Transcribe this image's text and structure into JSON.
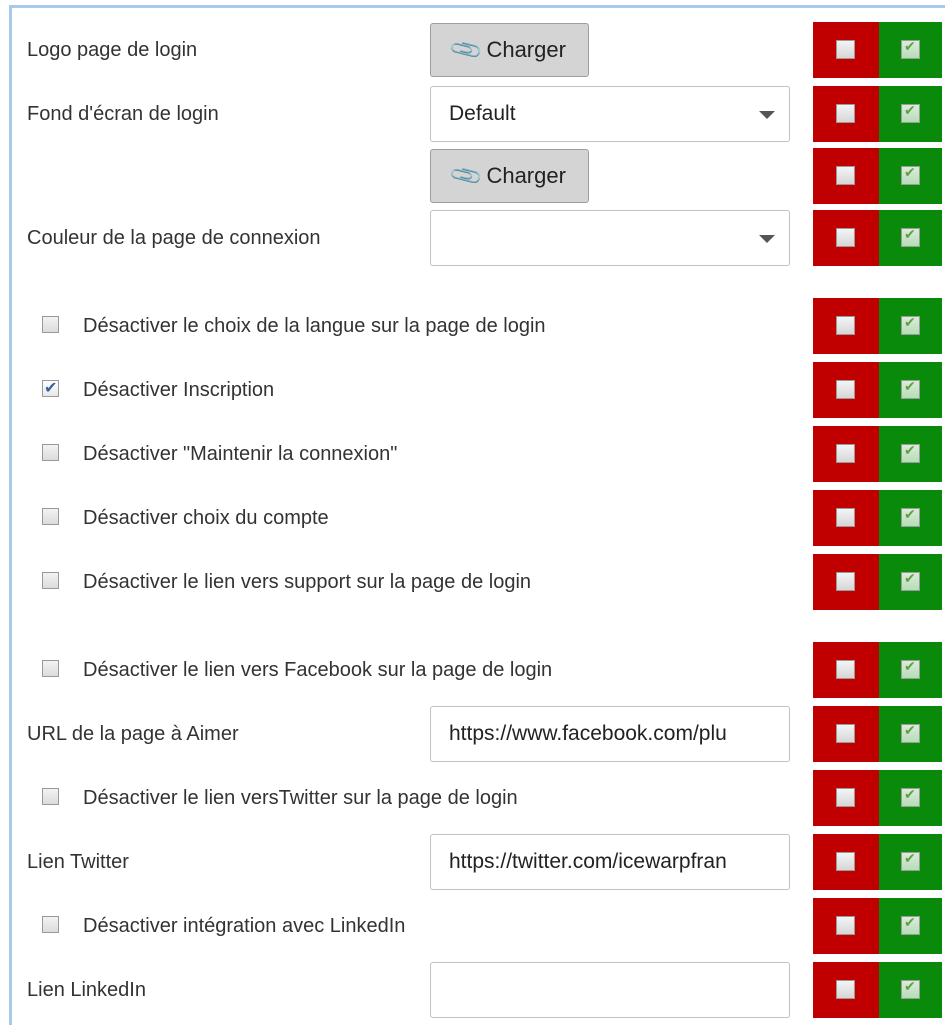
{
  "rows": {
    "logo": {
      "label": "Logo page de login",
      "button": "Charger"
    },
    "background": {
      "label": "Fond d'écran de login",
      "select_value": "Default",
      "button": "Charger"
    },
    "color": {
      "label": "Couleur de la page de connexion",
      "select_value": ""
    },
    "disable_language": {
      "label": "Désactiver le choix de la langue sur la page de login",
      "checked": false
    },
    "disable_signup": {
      "label": "Désactiver Inscription",
      "checked": true
    },
    "disable_remember": {
      "label": "Désactiver \"Maintenir la connexion\"",
      "checked": false
    },
    "disable_account": {
      "label": "Désactiver choix du compte",
      "checked": false
    },
    "disable_support": {
      "label": "Désactiver le lien vers support sur la page de login",
      "checked": false
    },
    "disable_facebook": {
      "label": "Désactiver le lien vers Facebook sur la page de login",
      "checked": false
    },
    "facebook_url": {
      "label": "URL de la page à Aimer",
      "value": "https://www.facebook.com/plu"
    },
    "disable_twitter": {
      "label": "Désactiver le lien versTwitter sur la page de login",
      "checked": false
    },
    "twitter_url": {
      "label": "Lien Twitter",
      "value": "https://twitter.com/icewarpfran"
    },
    "disable_linkedin": {
      "label": "Désactiver intégration avec LinkedIn",
      "checked": false
    },
    "linkedin_url": {
      "label": "Lien LinkedIn",
      "value": ""
    }
  },
  "icons": {
    "upload": "paperclip-icon",
    "dropdown": "chevron-down-icon"
  },
  "colors": {
    "deny": "#c00000",
    "allow": "#0a8a0a",
    "panel_border": "#a7c9ea"
  }
}
